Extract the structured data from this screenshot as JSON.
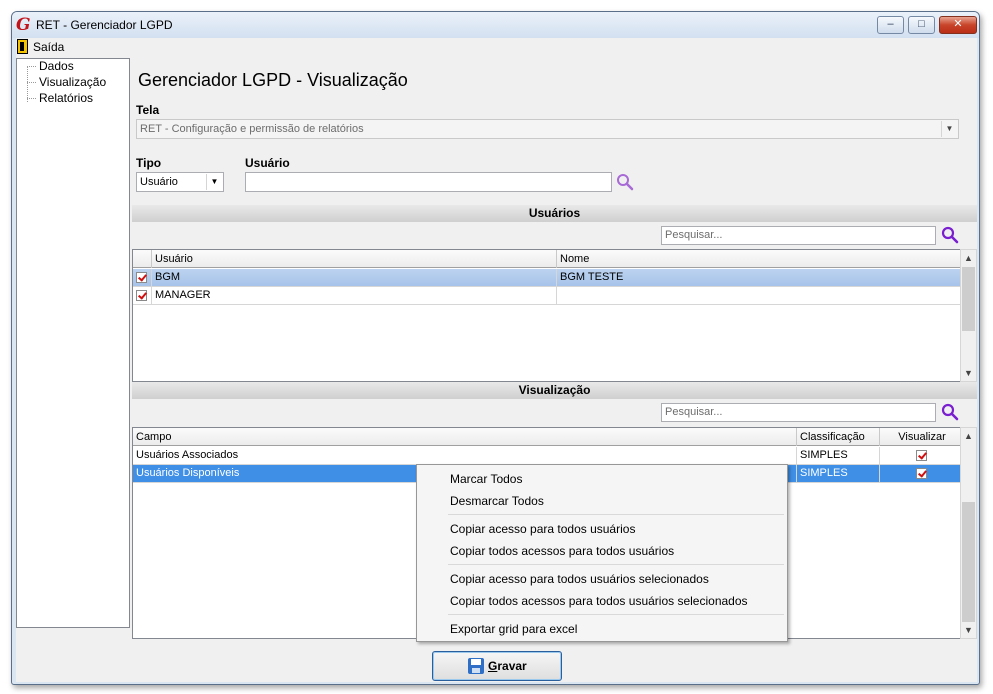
{
  "window": {
    "title": "RET - Gerenciador LGPD",
    "logo_icon": "app-logo-icon",
    "minimize_glyph": "–",
    "maximize_glyph": "□",
    "close_glyph": "✕"
  },
  "menubar": {
    "exit_label": "Saída"
  },
  "tree": {
    "items": [
      "Dados",
      "Visualização",
      "Relatórios"
    ]
  },
  "page": {
    "title": "Gerenciador LGPD - Visualização"
  },
  "form": {
    "tela_label": "Tela",
    "tela_value": "RET - Configuração e permissão de relatórios",
    "tipo_label": "Tipo",
    "tipo_value": "Usuário",
    "usuario_label": "Usuário",
    "usuario_value": ""
  },
  "usuarios_section": {
    "title": "Usuários",
    "search_placeholder": "Pesquisar...",
    "columns": [
      "Usuário",
      "Nome"
    ],
    "rows": [
      {
        "checked": true,
        "usuario": "BGM",
        "nome": "BGM TESTE",
        "selected": true
      },
      {
        "checked": true,
        "usuario": "MANAGER",
        "nome": "",
        "selected": false
      }
    ]
  },
  "visualizacao_section": {
    "title": "Visualização",
    "search_placeholder": "Pesquisar...",
    "columns": [
      "Campo",
      "Classificação",
      "Visualizar"
    ],
    "rows": [
      {
        "campo": "Usuários Associados",
        "classificacao": "SIMPLES",
        "visualizar": true,
        "selected": false
      },
      {
        "campo": "Usuários Disponíveis",
        "classificacao": "SIMPLES",
        "visualizar": true,
        "selected": true
      }
    ]
  },
  "context_menu": {
    "items": [
      "Marcar Todos",
      "Desmarcar Todos",
      "Copiar acesso para todos usuários",
      "Copiar todos acessos para todos usuários",
      "Copiar acesso para todos usuários selecionados",
      "Copiar todos acessos para todos usuários selecionados",
      "Exportar grid para excel"
    ]
  },
  "footer": {
    "save_label_first": "G",
    "save_label_rest": "ravar"
  },
  "colors": {
    "accent_search": "#8a2be2",
    "selected_row": "#3f8fe6",
    "check_mark": "#d01010"
  }
}
